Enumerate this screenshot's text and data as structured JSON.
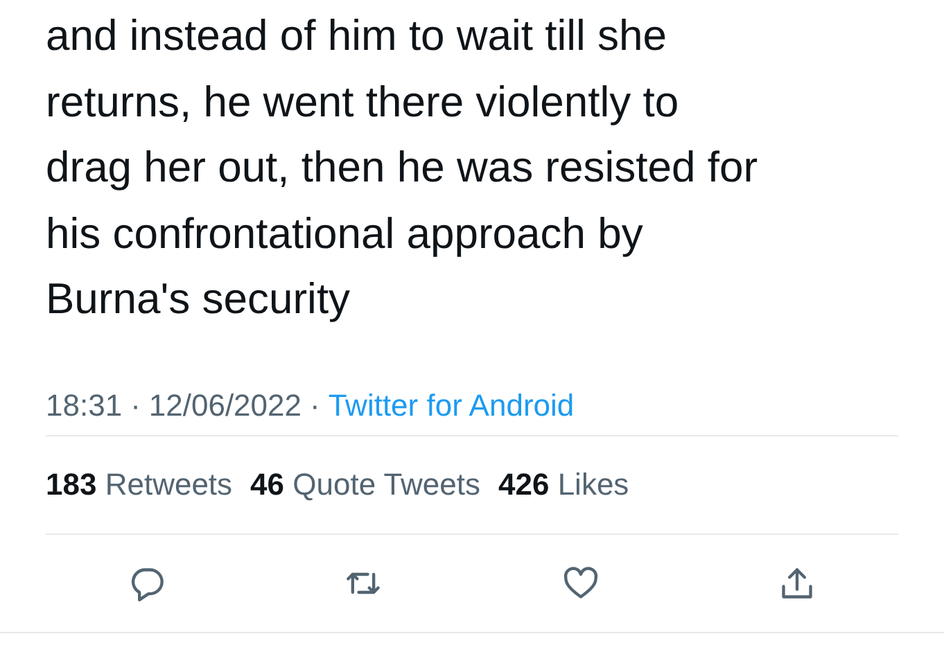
{
  "tweet": {
    "text_lines": [
      "and instead of him to wait till she",
      "returns, he went there violently to",
      "drag her out, then he was resisted for",
      "his confrontational approach by",
      "Burna's security"
    ],
    "time": "18:31",
    "separator": "·",
    "date": "12/06/2022",
    "source": "Twitter for Android"
  },
  "stats": [
    {
      "count": "183",
      "label": "Retweets"
    },
    {
      "count": "46",
      "label": "Quote Tweets"
    },
    {
      "count": "426",
      "label": "Likes"
    }
  ],
  "actions": [
    {
      "kind": "reply"
    },
    {
      "kind": "retweet"
    },
    {
      "kind": "like"
    },
    {
      "kind": "share"
    }
  ]
}
